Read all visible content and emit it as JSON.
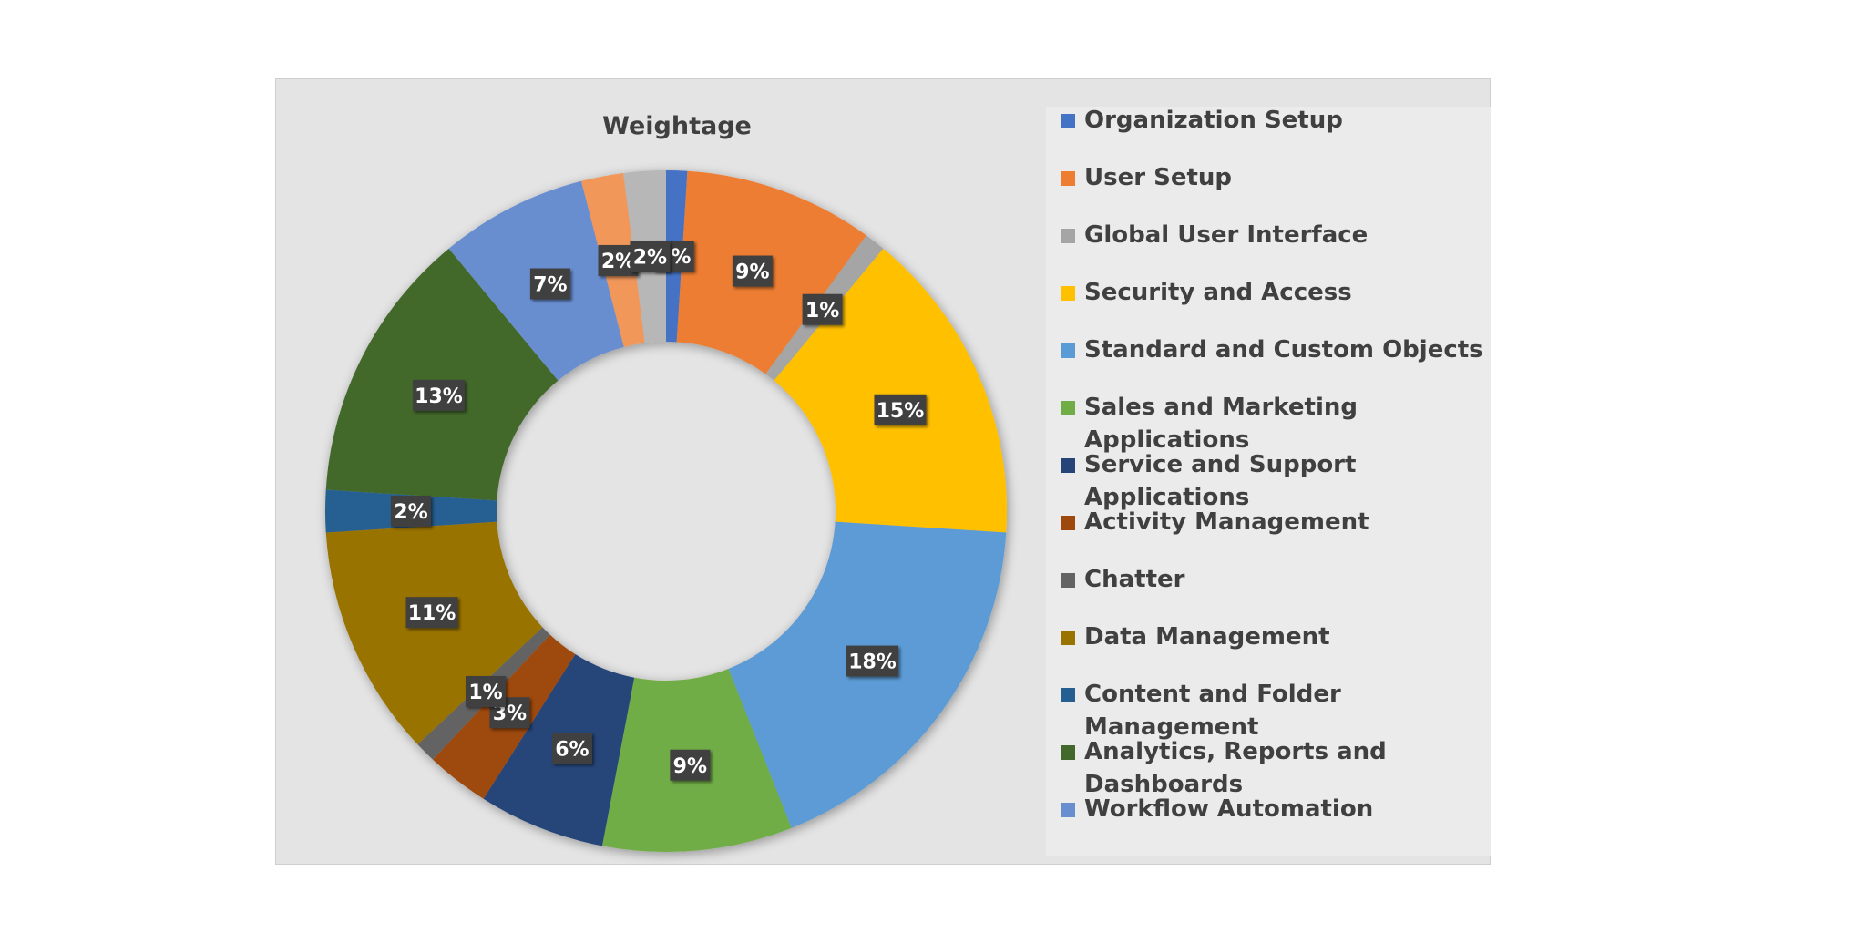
{
  "chart_data": {
    "type": "pie",
    "variant": "donut",
    "title": "Weightage",
    "legend_position": "right",
    "slices": [
      {
        "label": "Organization Setup",
        "value": 1,
        "display": "1%",
        "color": "#4472c4"
      },
      {
        "label": "User Setup",
        "value": 9,
        "display": "9%",
        "color": "#ed7d31"
      },
      {
        "label": "Global User Interface",
        "value": 1,
        "display": "1%",
        "color": "#a5a5a5"
      },
      {
        "label": "Security and Access",
        "value": 15,
        "display": "15%",
        "color": "#ffc000"
      },
      {
        "label": "Standard and Custom Objects",
        "value": 18,
        "display": "18%",
        "color": "#5b9bd5"
      },
      {
        "label": "Sales and Marketing Applications",
        "value": 9,
        "display": "9%",
        "color": "#70ad47"
      },
      {
        "label": "Service and Support Applications",
        "value": 6,
        "display": "6%",
        "color": "#264478"
      },
      {
        "label": "Activity Management",
        "value": 3,
        "display": "3%",
        "color": "#9e480e"
      },
      {
        "label": "Chatter",
        "value": 1,
        "display": "1%",
        "color": "#636363"
      },
      {
        "label": "Data Management",
        "value": 11,
        "display": "11%",
        "color": "#997300"
      },
      {
        "label": "Content and Folder Management",
        "value": 2,
        "display": "2%",
        "color": "#255e91"
      },
      {
        "label": "Analytics, Reports and Dashboards",
        "value": 13,
        "display": "13%",
        "color": "#43682b"
      },
      {
        "label": "Workflow Automation",
        "value": 7,
        "display": "7%",
        "color": "#698ed0"
      },
      {
        "label": "",
        "value": 2,
        "display": "2%",
        "color": "#f1975a"
      },
      {
        "label": "",
        "value": 2,
        "display": "2%",
        "color": "#b7b7b7"
      }
    ]
  },
  "legend": {
    "items": [
      {
        "label": "Organization Setup",
        "color": "#4472c4"
      },
      {
        "label": "User Setup",
        "color": "#ed7d31"
      },
      {
        "label": "Global User Interface",
        "color": "#a5a5a5"
      },
      {
        "label": "Security and Access",
        "color": "#ffc000"
      },
      {
        "label": "Standard and Custom Objects",
        "color": "#5b9bd5"
      },
      {
        "label": "Sales and Marketing Applications",
        "color": "#70ad47"
      },
      {
        "label": "Service and Support Applications",
        "color": "#264478"
      },
      {
        "label": "Activity Management",
        "color": "#9e480e"
      },
      {
        "label": "Chatter",
        "color": "#636363"
      },
      {
        "label": "Data Management",
        "color": "#997300"
      },
      {
        "label": "Content and Folder Management",
        "color": "#255e91"
      },
      {
        "label": "Analytics, Reports and Dashboards",
        "color": "#43682b"
      },
      {
        "label": "Workflow Automation",
        "color": "#698ed0"
      }
    ]
  }
}
